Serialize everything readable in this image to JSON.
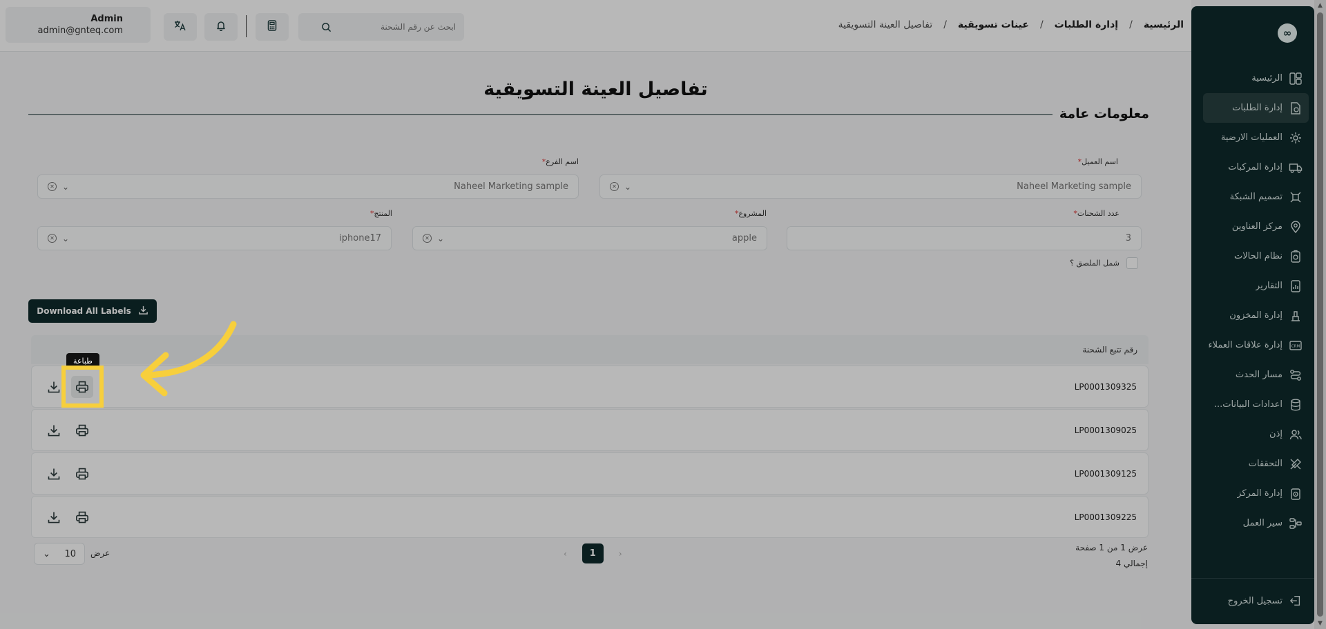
{
  "header": {
    "breadcrumb": [
      "الرئيسية",
      "إدارة الطلبات",
      "عينات تسويقية",
      "تفاصيل العينة التسويقية"
    ],
    "separator": "/",
    "search_placeholder": "ابحث عن رقم الشحنة",
    "user_name": "Admin",
    "user_email": "admin@gnteq.com"
  },
  "sidebar": {
    "logo_glyph": "∞",
    "items": [
      {
        "label": "الرئيسية",
        "icon": "dashboard-icon"
      },
      {
        "label": "إدارة الطلبات",
        "icon": "orders-icon",
        "active": true
      },
      {
        "label": "العمليات الارضية",
        "icon": "gear-icon"
      },
      {
        "label": "إدارة المركبات",
        "icon": "truck-icon"
      },
      {
        "label": "تصميم الشبكة",
        "icon": "network-icon"
      },
      {
        "label": "مركز العناوين",
        "icon": "map-pin-icon"
      },
      {
        "label": "نظام الحالات",
        "icon": "status-icon"
      },
      {
        "label": "التقارير",
        "icon": "report-icon"
      },
      {
        "label": "إدارة المخزون",
        "icon": "inventory-icon"
      },
      {
        "label": "إدارة علاقات العملاء",
        "icon": "crm-icon"
      },
      {
        "label": "مسار الحدث",
        "icon": "route-icon"
      },
      {
        "label": "اعدادات البيانات...",
        "icon": "database-icon"
      },
      {
        "label": "إذن",
        "icon": "users-icon"
      },
      {
        "label": "التحققات",
        "icon": "tools-icon"
      },
      {
        "label": "إدارة المركز",
        "icon": "center-icon"
      },
      {
        "label": "سير العمل",
        "icon": "workflow-icon"
      }
    ],
    "logout": "تسجيل الخروج"
  },
  "page": {
    "title": "تفاصيل العينة التسويقية",
    "section_title": "معلومات عامة"
  },
  "form": {
    "customer_label": "اسم العميل",
    "customer_value": "Naheel Marketing sample",
    "branch_label": "اسم الفرع",
    "branch_value": "Naheel Marketing sample",
    "shipments_label": "عدد الشحنات",
    "shipments_value": "3",
    "project_label": "المشروع",
    "project_value": "apple",
    "product_label": "المنتج",
    "product_value": "iphone17",
    "required_mark": "*",
    "checkbox_label": "شمل الملصق ؟"
  },
  "actions": {
    "download_all": "Download All Labels"
  },
  "table": {
    "column_header": "رقم تتبع الشحنة",
    "rows": [
      "LP0001309325",
      "LP0001309025",
      "LP0001309125",
      "LP0001309225"
    ],
    "tooltip": "طباعة"
  },
  "pagination": {
    "info": "عرض 1 من 1 صفحة",
    "total": "إجمالي 4",
    "current_page": "1",
    "per_page_label": "عرض",
    "per_page_value": "10"
  },
  "colors": {
    "primary": "#0f2a2c",
    "highlight": "#f7cf3c",
    "arrow": "#f7cf3c"
  }
}
